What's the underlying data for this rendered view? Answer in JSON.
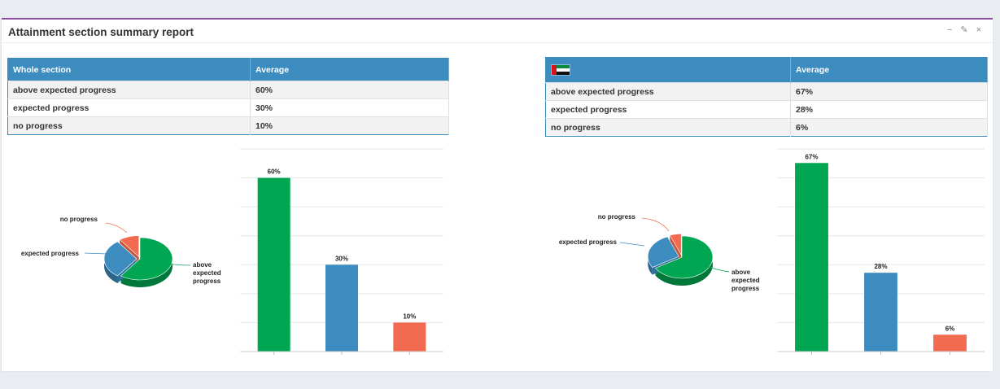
{
  "panel": {
    "title": "Attainment section summary report",
    "tools": {
      "minimize": "−",
      "settings": "✎",
      "close": "×"
    }
  },
  "colors": {
    "above": "#00a651",
    "expected": "#3d8cbf",
    "none": "#f26a4f",
    "header": "#3d8cbf",
    "accent_border": "#8a4f9c"
  },
  "left": {
    "table": {
      "headers": [
        "Whole section",
        "Average"
      ],
      "rows": [
        {
          "label": "above expected progress",
          "value": "60%"
        },
        {
          "label": "expected progress",
          "value": "30%"
        },
        {
          "label": "no progress",
          "value": "10%"
        }
      ]
    }
  },
  "right": {
    "table": {
      "header_icon": "uae-flag-icon",
      "headers": [
        "",
        "Average"
      ],
      "rows": [
        {
          "label": "above expected progress",
          "value": "67%"
        },
        {
          "label": "expected progress",
          "value": "28%"
        },
        {
          "label": "no progress",
          "value": "6%"
        }
      ]
    }
  },
  "chart_data": [
    {
      "type": "pie",
      "labels": [
        "above expected progress",
        "expected progress",
        "no progress"
      ],
      "values": [
        60,
        30,
        10
      ],
      "colors": [
        "#00a651",
        "#3d8cbf",
        "#f26a4f"
      ]
    },
    {
      "type": "bar",
      "categories": [
        "above expected progress",
        "expected progress",
        "no progress"
      ],
      "values": [
        60,
        30,
        10
      ],
      "data_labels": [
        "60%",
        "30%",
        "10%"
      ],
      "colors": [
        "#00a651",
        "#3d8cbf",
        "#f26a4f"
      ],
      "ylim": [
        0,
        70
      ],
      "grid": true
    },
    {
      "type": "pie",
      "labels": [
        "above expected progress",
        "expected progress",
        "no progress"
      ],
      "values": [
        67,
        28,
        6
      ],
      "colors": [
        "#00a651",
        "#3d8cbf",
        "#f26a4f"
      ]
    },
    {
      "type": "bar",
      "categories": [
        "above expected progress",
        "expected progress",
        "no progress"
      ],
      "values": [
        67,
        28,
        6
      ],
      "data_labels": [
        "67%",
        "28%",
        "6%"
      ],
      "colors": [
        "#00a651",
        "#3d8cbf",
        "#f26a4f"
      ],
      "ylim": [
        0,
        72
      ],
      "grid": true
    }
  ]
}
